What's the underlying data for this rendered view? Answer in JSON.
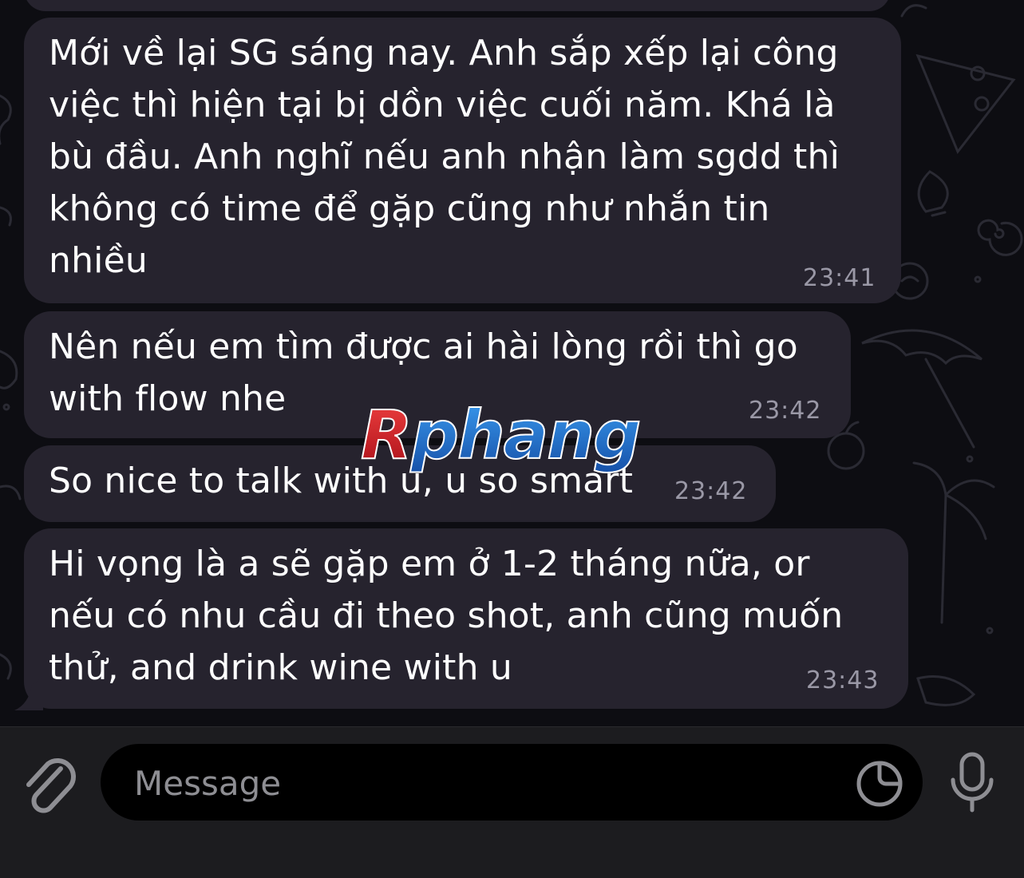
{
  "messages": [
    {
      "text": "Mới về lại SG sáng nay. Anh sắp xếp lại công\nviệc thì hiện tại bị dồn việc cuối năm. Khá là\nbù đầu. Anh nghĩ nếu anh nhận làm sgdd thì\nkhông có time để gặp cũng như nhắn tin\nnhiều",
      "time": "23:41"
    },
    {
      "text": "Nên nếu em tìm được ai hài lòng rồi thì go\nwith flow nhe",
      "time": "23:42"
    },
    {
      "text": "So nice to talk with u, u so smart",
      "time": "23:42"
    },
    {
      "text": "Hi vọng là a sẽ gặp em ở 1-2 tháng nữa, or\nnếu có nhu cầu đi theo shot, anh cũng muốn\nthử, and drink wine with u",
      "time": "23:43"
    }
  ],
  "watermark": "Rphang",
  "composer": {
    "placeholder": "Message",
    "value": ""
  },
  "icons": {
    "attach": "paperclip-icon",
    "sticker": "sticker-icon",
    "mic": "microphone-icon"
  },
  "colors": {
    "bubble": "#26232e",
    "time": "#9a98a6",
    "composer_bar": "#1c1c1f",
    "watermark_red": "#d81f2a",
    "watermark_blue": "#1f6fc4"
  }
}
